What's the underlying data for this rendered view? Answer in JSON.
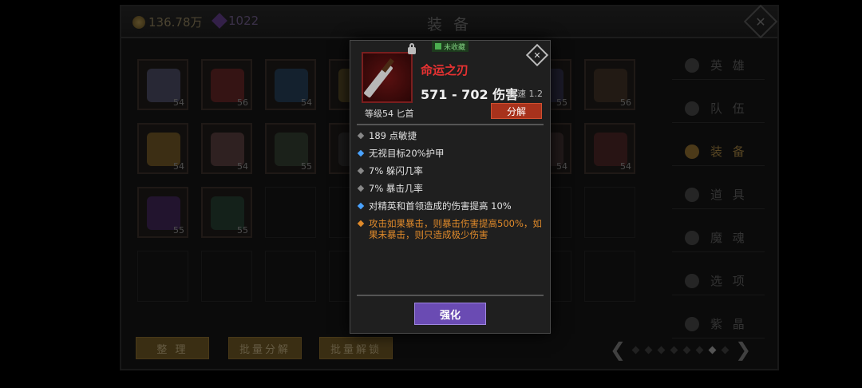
{
  "header": {
    "title": "装 备",
    "gold": "136.78万",
    "gems": "1022"
  },
  "slots": [
    {
      "level": "54"
    },
    {
      "level": "56"
    },
    {
      "level": "54"
    },
    {
      "level": ""
    },
    {
      "level": ""
    },
    {
      "level": "55"
    },
    {
      "level": "56"
    },
    {
      "level": "54"
    },
    {
      "level": "54"
    },
    {
      "level": "55"
    },
    {
      "level": ""
    },
    {
      "level": ""
    },
    {
      "level": "54"
    },
    {
      "level": "54"
    },
    {
      "level": "55"
    },
    {
      "level": "55"
    }
  ],
  "sidebar": {
    "items": [
      {
        "label": "英 雄"
      },
      {
        "label": "队 伍"
      },
      {
        "label": "装 备"
      },
      {
        "label": "道 具"
      },
      {
        "label": "魔 魂"
      },
      {
        "label": "选 项"
      },
      {
        "label": "紫 晶"
      }
    ]
  },
  "buttons": {
    "sort": "整 理",
    "batch_salvage": "批量分解",
    "batch_unlock": "批量解锁"
  },
  "pager": {
    "pages": 8,
    "current": 7
  },
  "popup": {
    "badge": "未收藏",
    "name": "命运之刃",
    "damage": "571 - 702 伤害",
    "speed": "攻速 1.2",
    "level_type": "等级54 匕首",
    "salvage": "分解",
    "stats": [
      {
        "text": "189 点敏捷",
        "color": "grey"
      },
      {
        "text": "无视目标20%护甲",
        "color": "blue"
      },
      {
        "text": "7% 躲闪几率",
        "color": "grey"
      },
      {
        "text": "7% 暴击几率",
        "color": "grey"
      },
      {
        "text": "对精英和首领造成的伤害提高 10%",
        "color": "blue"
      },
      {
        "text": "攻击如果暴击，则暴击伤害提高500%，如果未暴击，则只造成极少伤害",
        "color": "orange"
      }
    ],
    "enhance": "强化"
  }
}
